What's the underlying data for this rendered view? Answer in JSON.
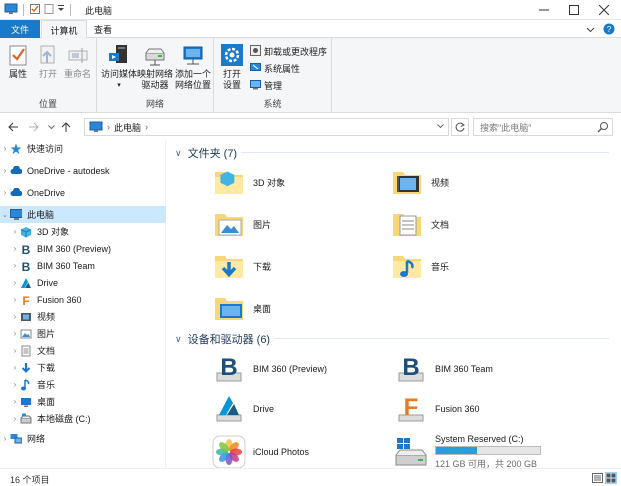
{
  "window": {
    "title": "此电脑"
  },
  "ribbon_tabs": {
    "file": "文件",
    "computer": "计算机",
    "view": "查看"
  },
  "ribbon": {
    "location": {
      "label": "位置",
      "properties": "属性",
      "open": "打开",
      "rename": "重命名"
    },
    "network": {
      "label": "网络",
      "access_media": "访问媒体",
      "map_drive_1": "映射网络",
      "map_drive_2": "驱动器",
      "add_location_1": "添加一个",
      "add_location_2": "网络位置"
    },
    "system": {
      "label": "系统",
      "open_settings_1": "打开",
      "open_settings_2": "设置",
      "uninstall": "卸载或更改程序",
      "system_properties": "系统属性",
      "manage": "管理"
    }
  },
  "address": {
    "crumb": "此电脑",
    "search_placeholder": "搜索\"此电脑\""
  },
  "nav": {
    "quick_access": "快速访问",
    "onedrive_autodesk": "OneDrive - autodesk",
    "onedrive": "OneDrive",
    "this_pc": "此电脑",
    "items": [
      "3D 对象",
      "BIM 360 (Preview)",
      "BIM 360 Team",
      "Drive",
      "Fusion 360",
      "视频",
      "图片",
      "文档",
      "下载",
      "音乐",
      "桌面",
      "本地磁盘 (C:)"
    ],
    "network": "网络"
  },
  "folders": {
    "heading": "文件夹 (7)",
    "items": [
      "3D 对象",
      "视频",
      "图片",
      "文档",
      "下载",
      "音乐",
      "桌面"
    ]
  },
  "devices": {
    "heading": "设备和驱动器 (6)",
    "items": [
      "BIM 360 (Preview)",
      "BIM 360 Team",
      "Drive",
      "Fusion 360",
      "iCloud Photos",
      "System Reserved (C:)"
    ],
    "drive_free": "121 GB 可用，共 200 GB",
    "drive_used_fraction": 0.395
  },
  "status": {
    "count": "16 个项目"
  },
  "colors": {
    "accent": "#1979ca",
    "selection": "#cce8ff",
    "folder": "#f8d775",
    "drivebar": "#26a0da"
  }
}
